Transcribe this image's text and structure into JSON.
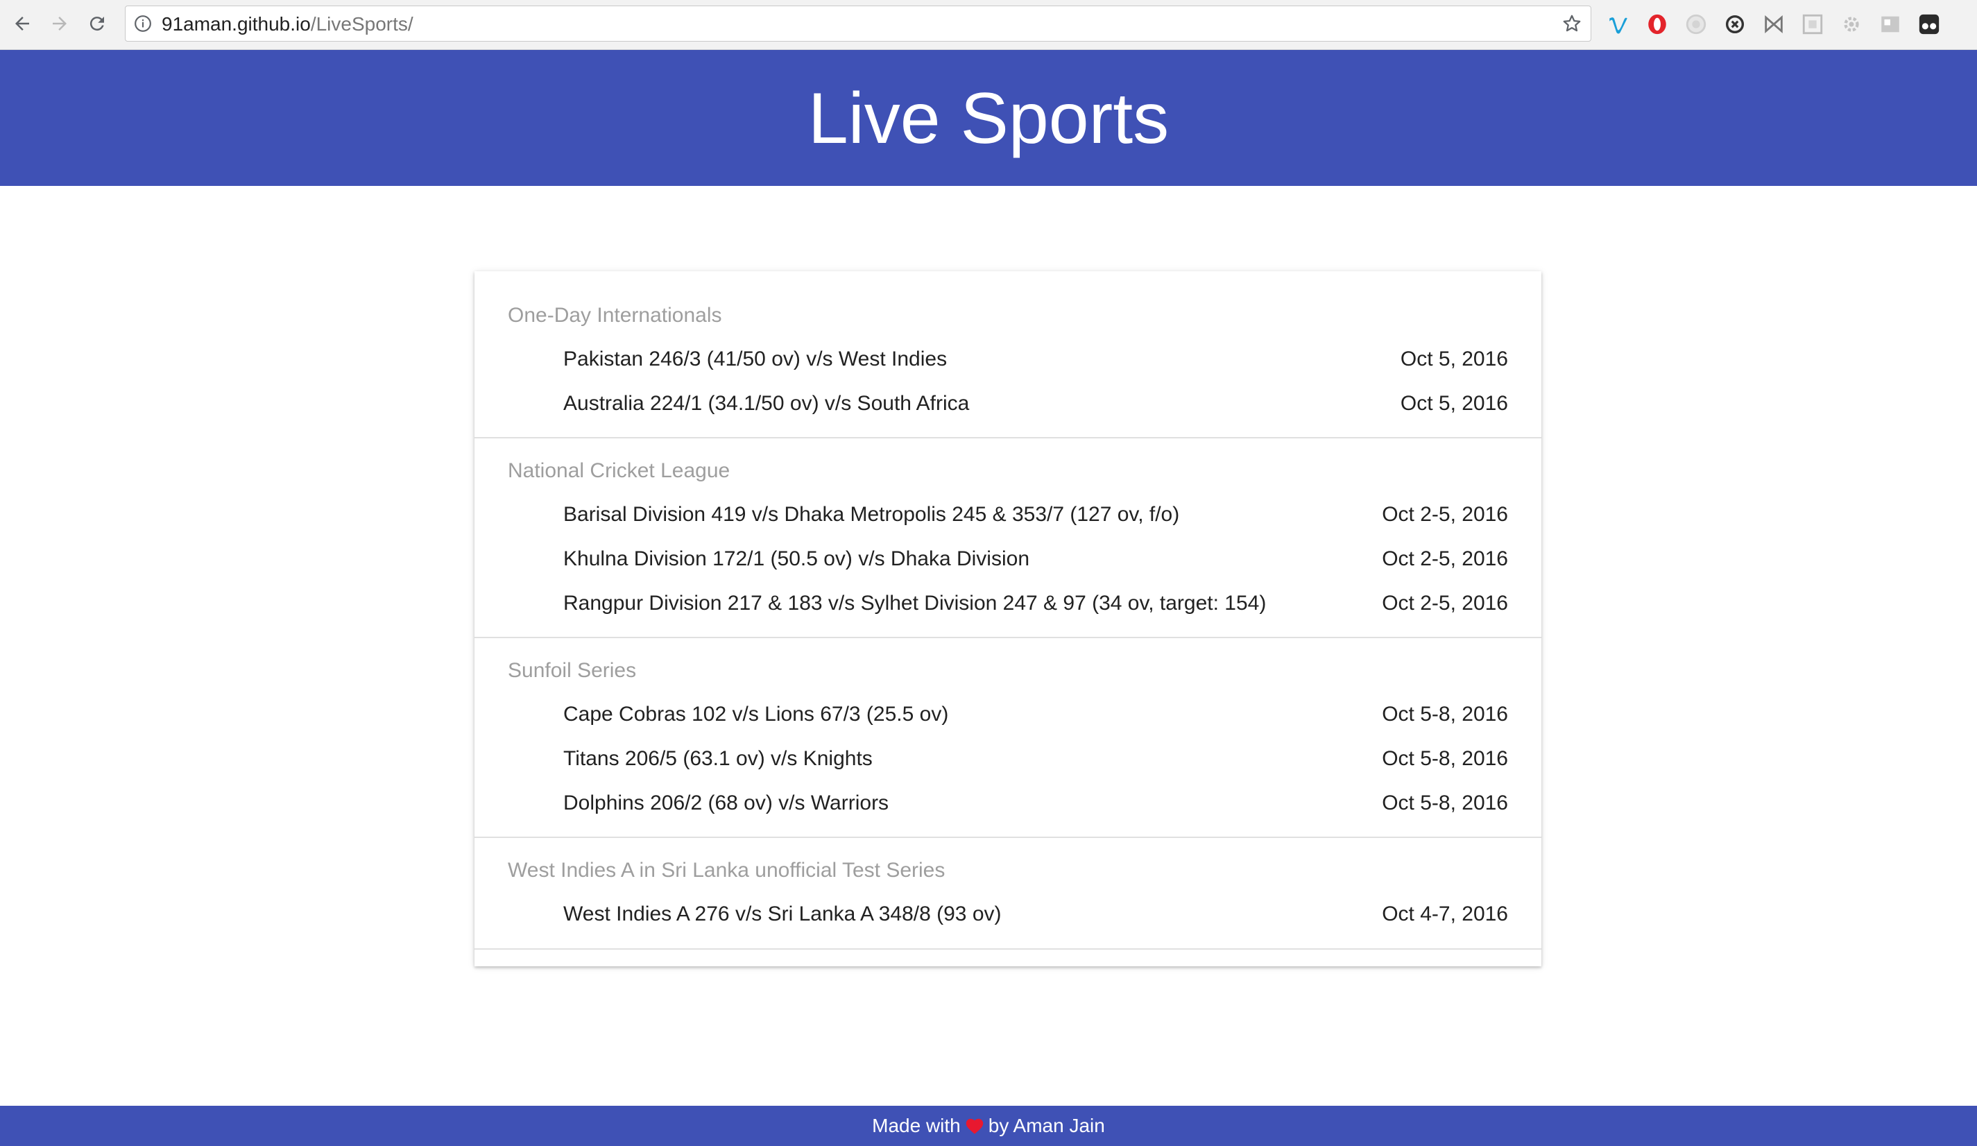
{
  "browser": {
    "url_host": "91aman.github.io",
    "url_path": "/LiveSports/",
    "icons": [
      "back-arrow-icon",
      "forward-arrow-icon",
      "reload-icon",
      "info-icon",
      "star-icon"
    ],
    "extensions": [
      "vimeo-extension-icon",
      "opera-extension-icon",
      "circle-extension-icon",
      "sync-extension-icon",
      "bow-tie-extension-icon",
      "grid-extension-icon",
      "gear-extension-icon",
      "image-extension-icon",
      "tampermonkey-extension-icon"
    ]
  },
  "header": {
    "title": "Live Sports",
    "color": "#3f51b5"
  },
  "series": [
    {
      "name": "One-Day Internationals",
      "matches": [
        {
          "text": "Pakistan 246/3 (41/50 ov) v/s West Indies",
          "date": "Oct 5, 2016"
        },
        {
          "text": "Australia 224/1 (34.1/50 ov) v/s South Africa",
          "date": "Oct 5, 2016"
        }
      ]
    },
    {
      "name": "National Cricket League",
      "matches": [
        {
          "text": "Barisal Division 419 v/s Dhaka Metropolis 245 & 353/7 (127 ov, f/o)",
          "date": "Oct 2-5, 2016"
        },
        {
          "text": "Khulna Division 172/1 (50.5 ov) v/s Dhaka Division",
          "date": "Oct 2-5, 2016"
        },
        {
          "text": "Rangpur Division 217 & 183 v/s Sylhet Division 247 & 97 (34 ov, target: 154)",
          "date": "Oct 2-5, 2016"
        }
      ]
    },
    {
      "name": "Sunfoil Series",
      "matches": [
        {
          "text": "Cape Cobras 102 v/s Lions 67/3 (25.5 ov)",
          "date": "Oct 5-8, 2016"
        },
        {
          "text": "Titans 206/5 (63.1 ov) v/s Knights",
          "date": "Oct 5-8, 2016"
        },
        {
          "text": "Dolphins 206/2 (68 ov) v/s Warriors",
          "date": "Oct 5-8, 2016"
        }
      ]
    },
    {
      "name": "West Indies A in Sri Lanka unofficial Test Series",
      "matches": [
        {
          "text": "West Indies A 276 v/s Sri Lanka A 348/8 (93 ov)",
          "date": "Oct 4-7, 2016"
        }
      ]
    }
  ],
  "footer": {
    "prefix": "Made with",
    "suffix": "by Aman Jain",
    "heart_color": "#e8182f"
  }
}
